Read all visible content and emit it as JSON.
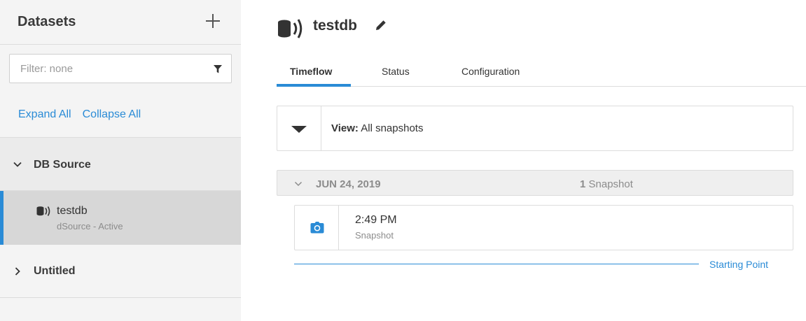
{
  "sidebar": {
    "title": "Datasets",
    "filter": {
      "placeholder": "Filter: none",
      "value": ""
    },
    "expand_all": "Expand All",
    "collapse_all": "Collapse All",
    "groups": [
      {
        "label": "DB Source",
        "expanded": true,
        "items": [
          {
            "name": "testdb",
            "subtitle": "dSource - Active",
            "selected": true,
            "icon": "database-broadcast-icon"
          }
        ]
      },
      {
        "label": "Untitled",
        "expanded": false,
        "items": []
      }
    ]
  },
  "main": {
    "title": "testdb",
    "tabs": [
      {
        "label": "Timeflow",
        "active": true
      },
      {
        "label": "Status",
        "active": false
      },
      {
        "label": "Configuration",
        "active": false
      }
    ],
    "view": {
      "prefix": "View:",
      "value": "All snapshots"
    },
    "date_group": {
      "date": "JUN 24, 2019",
      "count": "1",
      "count_label": "Snapshot"
    },
    "snapshot": {
      "time": "2:49 PM",
      "label": "Snapshot",
      "icon": "camera-icon"
    },
    "starting_point": "Starting Point"
  },
  "colors": {
    "accent": "#2a8bd6",
    "sidebar_bg": "#f4f4f4",
    "selected_bg": "#d7d7d7"
  }
}
